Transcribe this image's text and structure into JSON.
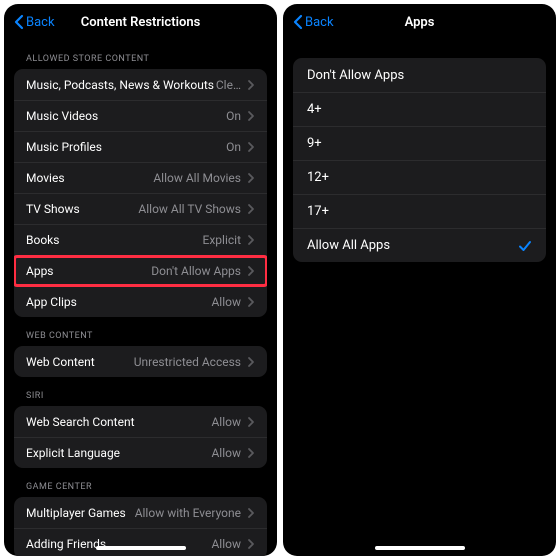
{
  "left": {
    "back": "Back",
    "title": "Content Restrictions",
    "sections": [
      {
        "header": "ALLOWED STORE CONTENT",
        "rows": [
          {
            "label": "Music, Podcasts, News & Workouts",
            "value": "Cle…"
          },
          {
            "label": "Music Videos",
            "value": "On"
          },
          {
            "label": "Music Profiles",
            "value": "On"
          },
          {
            "label": "Movies",
            "value": "Allow All Movies"
          },
          {
            "label": "TV Shows",
            "value": "Allow All TV Shows"
          },
          {
            "label": "Books",
            "value": "Explicit"
          },
          {
            "label": "Apps",
            "value": "Don't Allow Apps",
            "highlight": true
          },
          {
            "label": "App Clips",
            "value": "Allow"
          }
        ]
      },
      {
        "header": "WEB CONTENT",
        "rows": [
          {
            "label": "Web Content",
            "value": "Unrestricted Access"
          }
        ]
      },
      {
        "header": "SIRI",
        "rows": [
          {
            "label": "Web Search Content",
            "value": "Allow"
          },
          {
            "label": "Explicit Language",
            "value": "Allow"
          }
        ]
      },
      {
        "header": "GAME CENTER",
        "rows": [
          {
            "label": "Multiplayer Games",
            "value": "Allow with Everyone"
          },
          {
            "label": "Adding Friends",
            "value": "Allow"
          }
        ]
      }
    ]
  },
  "right": {
    "back": "Back",
    "title": "Apps",
    "options": [
      {
        "label": "Don't Allow Apps",
        "checked": false
      },
      {
        "label": "4+",
        "checked": false
      },
      {
        "label": "9+",
        "checked": false
      },
      {
        "label": "12+",
        "checked": false
      },
      {
        "label": "17+",
        "checked": false
      },
      {
        "label": "Allow All Apps",
        "checked": true
      }
    ]
  }
}
